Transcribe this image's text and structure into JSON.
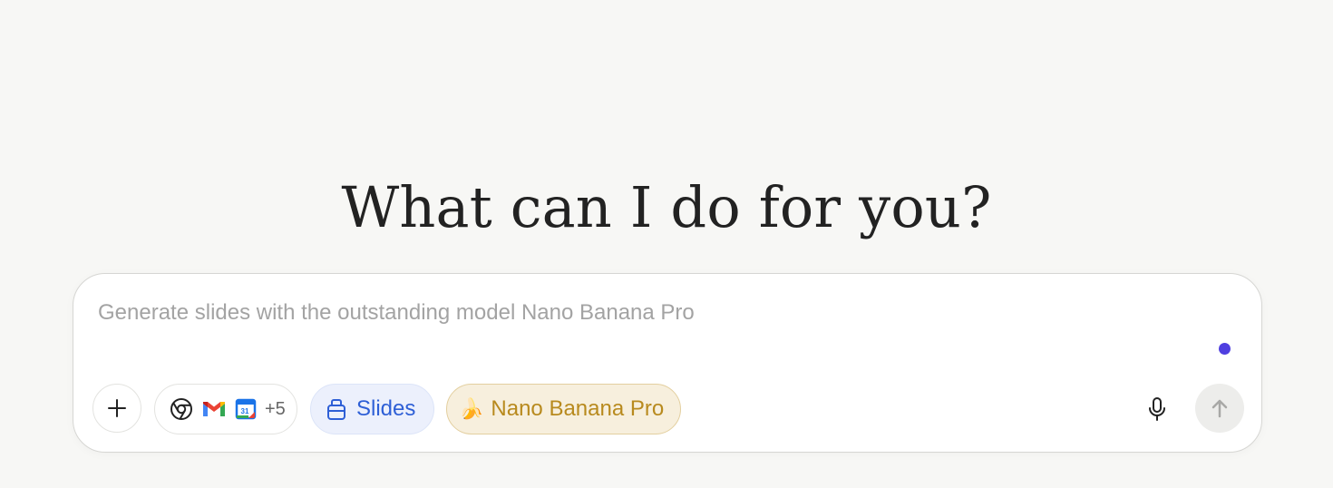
{
  "hero": {
    "title": "What can I do for you?"
  },
  "composer": {
    "placeholder": "Generate slides with the outstanding model Nano Banana Pro",
    "value": "",
    "status_dot_color": "#4f3fe0",
    "add_button_icon": "plus-icon",
    "connectors": {
      "icons": [
        "chrome-icon",
        "gmail-icon",
        "google-calendar-icon"
      ],
      "calendar_day": "31",
      "more_label": "+5"
    },
    "slides_chip": {
      "icon": "slides-icon",
      "label": "Slides",
      "color": "#2e5fd6"
    },
    "model_chip": {
      "icon": "banana-emoji",
      "emoji": "🍌",
      "label": "Nano Banana Pro",
      "color": "#b88a1e"
    },
    "mic_icon": "microphone-icon",
    "send_icon": "arrow-up-icon"
  }
}
